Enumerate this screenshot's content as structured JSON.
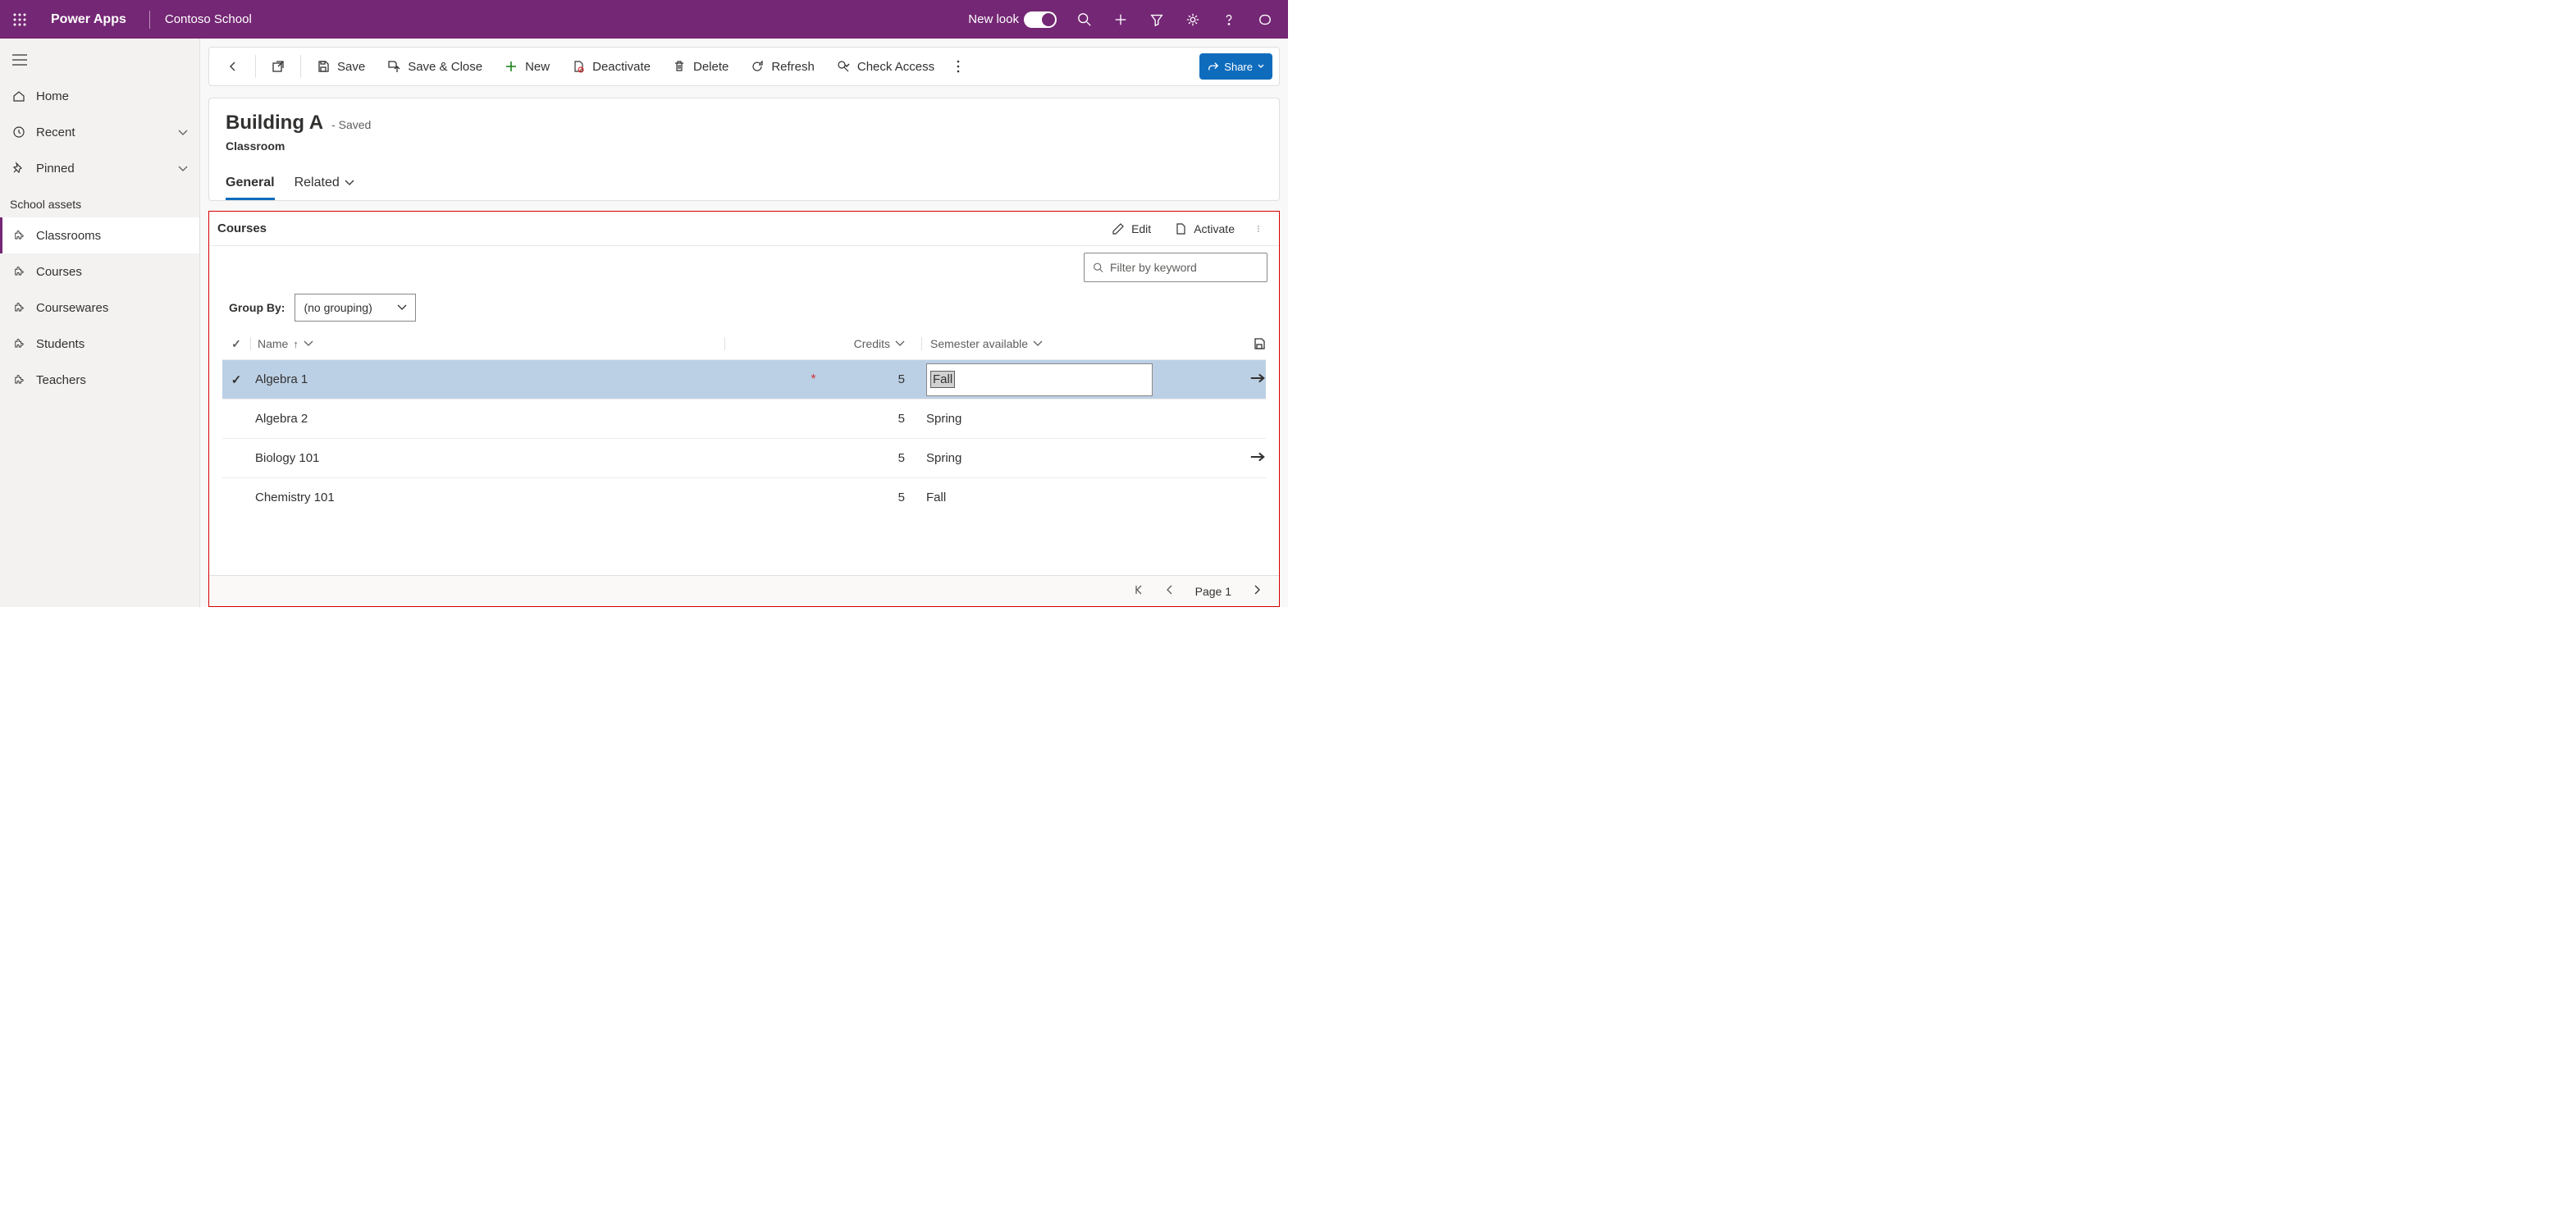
{
  "header": {
    "brand": "Power Apps",
    "tenant": "Contoso School",
    "newlook_label": "New look"
  },
  "sidebar": {
    "home": "Home",
    "recent": "Recent",
    "pinned": "Pinned",
    "group_label": "School assets",
    "items": [
      {
        "label": "Classrooms"
      },
      {
        "label": "Courses"
      },
      {
        "label": "Coursewares"
      },
      {
        "label": "Students"
      },
      {
        "label": "Teachers"
      }
    ]
  },
  "commands": {
    "save": "Save",
    "save_close": "Save & Close",
    "new": "New",
    "deactivate": "Deactivate",
    "delete": "Delete",
    "refresh": "Refresh",
    "check_access": "Check Access",
    "share": "Share"
  },
  "record": {
    "title": "Building A",
    "saved_suffix": "- Saved",
    "subtitle": "Classroom",
    "tab_general": "General",
    "tab_related": "Related"
  },
  "subgrid": {
    "title": "Courses",
    "edit": "Edit",
    "activate": "Activate",
    "filter_placeholder": "Filter by keyword",
    "groupby_label": "Group By:",
    "groupby_value": "(no grouping)",
    "columns": {
      "name": "Name",
      "credits": "Credits",
      "semester": "Semester available"
    },
    "rows": [
      {
        "name": "Algebra 1",
        "credits": "5",
        "semester": "Fall",
        "selected": true,
        "editing": true,
        "required": true,
        "has_arrow": true
      },
      {
        "name": "Algebra 2",
        "credits": "5",
        "semester": "Spring"
      },
      {
        "name": "Biology 101",
        "credits": "5",
        "semester": "Spring",
        "has_arrow": true
      },
      {
        "name": "Chemistry 101",
        "credits": "5",
        "semester": "Fall"
      }
    ],
    "pager_label": "Page 1"
  }
}
